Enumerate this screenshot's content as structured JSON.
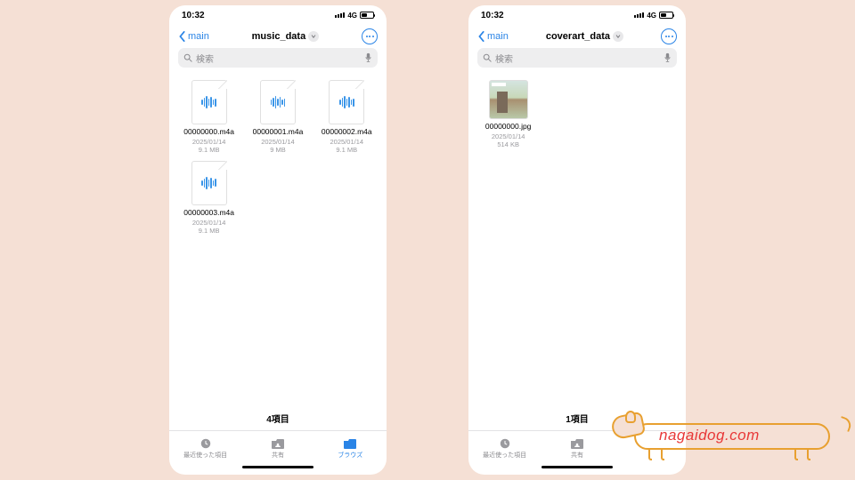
{
  "status": {
    "time": "10:32",
    "network": "4G"
  },
  "phones": [
    {
      "back_label": "main",
      "title": "music_data",
      "search_placeholder": "検索",
      "files": [
        {
          "name": "00000000.m4a",
          "date": "2025/01/14",
          "size": "9.1 MB",
          "kind": "audio"
        },
        {
          "name": "00000001.m4a",
          "date": "2025/01/14",
          "size": "9 MB",
          "kind": "audio"
        },
        {
          "name": "00000002.m4a",
          "date": "2025/01/14",
          "size": "9.1 MB",
          "kind": "audio"
        },
        {
          "name": "00000003.m4a",
          "date": "2025/01/14",
          "size": "9.1 MB",
          "kind": "audio"
        }
      ],
      "count_label": "4項目",
      "tabs": [
        {
          "label": "最近使った項目",
          "active": false,
          "icon": "clock"
        },
        {
          "label": "共有",
          "active": false,
          "icon": "folder-share"
        },
        {
          "label": "ブラウズ",
          "active": true,
          "icon": "folder"
        }
      ]
    },
    {
      "back_label": "main",
      "title": "coverart_data",
      "search_placeholder": "検索",
      "files": [
        {
          "name": "00000000.jpg",
          "date": "2025/01/14",
          "size": "514 KB",
          "kind": "image"
        }
      ],
      "count_label": "1項目",
      "tabs": [
        {
          "label": "最近使った項目",
          "active": false,
          "icon": "clock"
        },
        {
          "label": "共有",
          "active": false,
          "icon": "folder-share"
        }
      ]
    }
  ],
  "watermark": "nagaidog.com"
}
